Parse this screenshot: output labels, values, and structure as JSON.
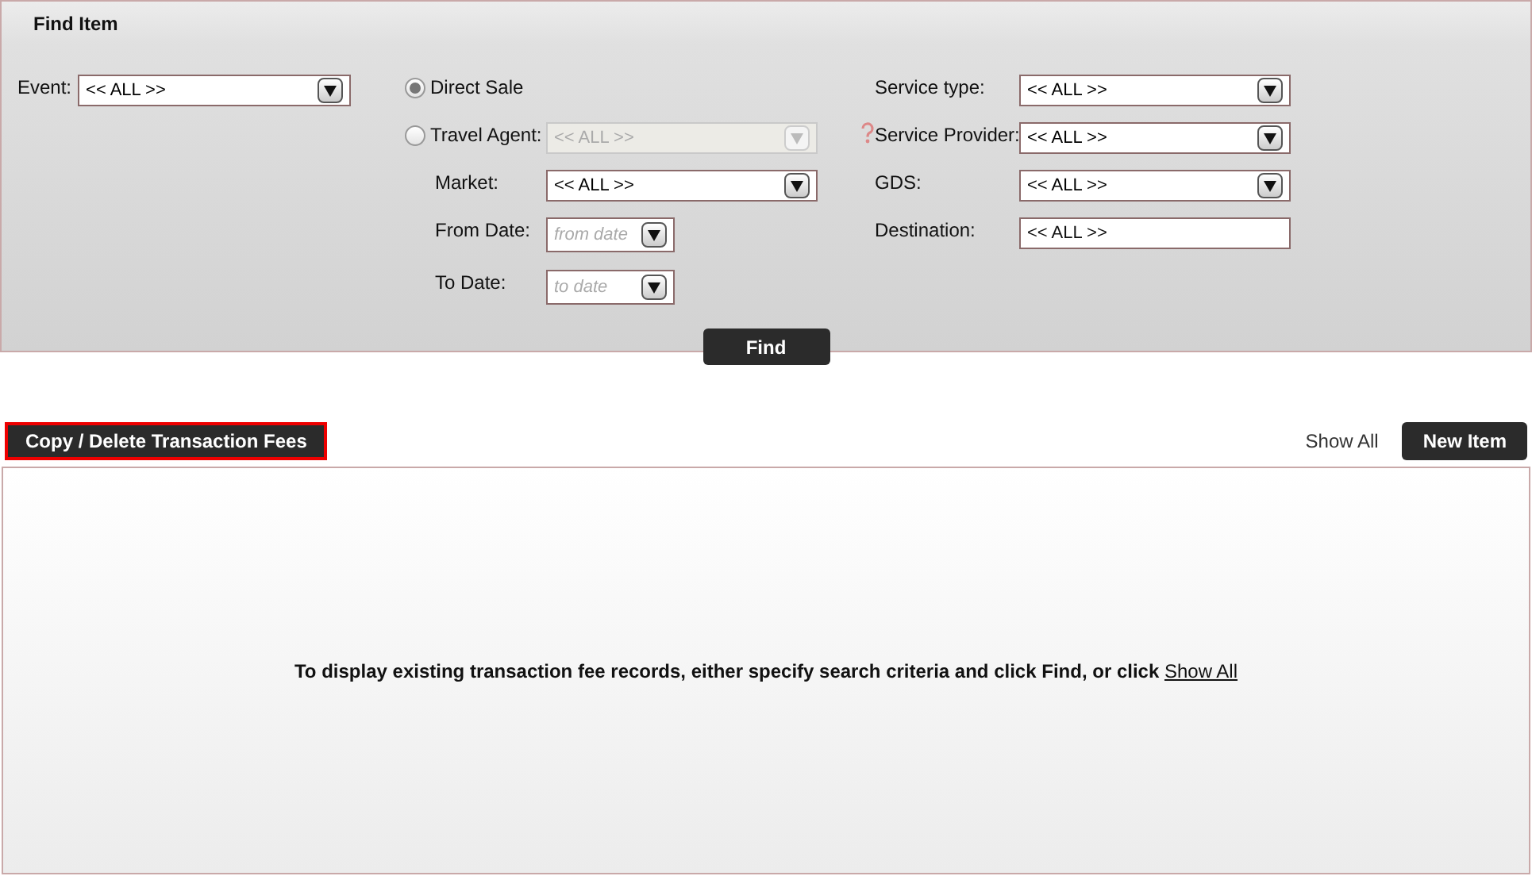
{
  "panel": {
    "title": "Find Item"
  },
  "event": {
    "label": "Event:",
    "value": "<< ALL >>"
  },
  "sale_type": [
    {
      "label": "Direct Sale",
      "selected": true
    },
    {
      "label": "Travel Agent:",
      "selected": false,
      "field": {
        "value": "<< ALL >>",
        "disabled": true
      }
    }
  ],
  "middle_fields": [
    {
      "label": "Market:",
      "kind": "select",
      "value": "<< ALL >>"
    },
    {
      "label": "From Date:",
      "kind": "date",
      "placeholder": "from date"
    },
    {
      "label": "To Date:",
      "kind": "date",
      "placeholder": "to date"
    }
  ],
  "right_fields": [
    {
      "label": "Service type:",
      "kind": "select",
      "value": "<< ALL >>",
      "help": false
    },
    {
      "label": "Service Provider:",
      "kind": "select",
      "value": "<< ALL >>",
      "help": true
    },
    {
      "label": "GDS:",
      "kind": "select",
      "value": "<< ALL >>",
      "help": false
    },
    {
      "label": "Destination:",
      "kind": "text",
      "value": "<< ALL >>",
      "help": false
    }
  ],
  "find_button": "Find",
  "copy_button": "Copy / Delete Transaction Fees",
  "show_all": "Show All",
  "new_button": "New Item",
  "results": {
    "message": "To display existing transaction fee records, either specify search criteria and click Find, or click",
    "link": "Show All"
  }
}
